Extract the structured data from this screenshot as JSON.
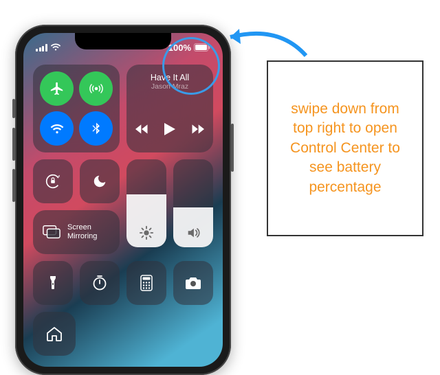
{
  "status": {
    "battery_percent": "100%"
  },
  "media": {
    "title": "Have It All",
    "artist": "Jason Mraz"
  },
  "mirror": {
    "line1": "Screen",
    "line2": "Mirroring"
  },
  "callout": {
    "text": "swipe down from top right to open Control Center to see battery percentage"
  }
}
